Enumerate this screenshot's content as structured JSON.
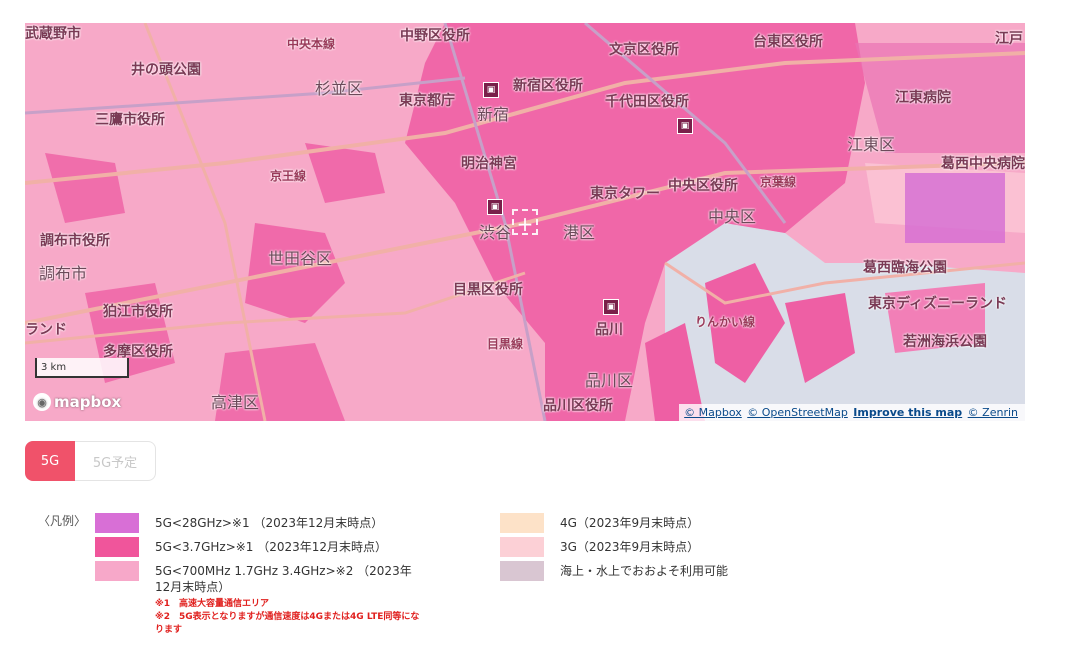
{
  "map": {
    "labels": {
      "nerima": "武蔵野市",
      "nakano_ku": "中野区役所",
      "chuo_line": "中央本線",
      "bunkyo": "文京区役所",
      "taito": "台東区役所",
      "edogawa": "江戸",
      "inokashira": "井の頭公園",
      "suginami": "杉並区",
      "tokyo_to": "東京都庁",
      "shinjuku_ku": "新宿区役所",
      "shinjuku": "新宿",
      "chiyoda": "千代田区役所",
      "koto_hosp": "江東病院",
      "mitaka": "三鷹市役所",
      "meiji": "明治神宮",
      "keio_line": "京王線",
      "koto": "江東区",
      "kasai": "葛西中央病院",
      "tokyo_tower": "東京タワー",
      "chuo_ku": "中央区役所",
      "chuo": "中央区",
      "keiyo": "京葉線",
      "chofu_yakusho": "調布市役所",
      "setagaya": "世田谷区",
      "shibuya": "渋谷",
      "minato": "港区",
      "chofu": "調布市",
      "higashi_kasai": "葛西臨海公園",
      "meguro": "目黒区役所",
      "komae": "狛江市役所",
      "disney": "東京ディズニーランド",
      "tama": "多摩区役所",
      "meguro_line": "目黒線",
      "shinagawa": "品川",
      "rinkai": "りんかい線",
      "wakasu": "若洲海浜公園",
      "lando": "ランド",
      "shinagawa_ku": "品川区",
      "takatsu": "高津区",
      "shinagawa_yakusho": "品川区役所",
      "nakano_road": "中野区役所"
    },
    "scale": "3 km",
    "logo": "mapbox",
    "attribution": {
      "mapbox": "© Mapbox",
      "osm": "© OpenStreetMap",
      "improve": "Improve this map",
      "zenrin": "© Zenrin"
    }
  },
  "tabs": {
    "active": "5G",
    "inactive": "5G予定"
  },
  "legend": {
    "title": "〈凡例〉",
    "items": [
      {
        "label": "5G<28GHz>※1 （2023年12月末時点）",
        "color": "#d86fd6"
      },
      {
        "label": "5G<3.7GHz>※1 （2023年12月末時点）",
        "color": "#f0559b"
      },
      {
        "label": "5G<700MHz 1.7GHz 3.4GHz>※2 （2023年12月末時点）",
        "color": "#f7a8c9"
      },
      {
        "label": "4G（2023年9月末時点）",
        "color": "#fde2c8"
      },
      {
        "label": "3G（2023年9月末時点）",
        "color": "#fcd0d6"
      },
      {
        "label": "海上・水上でおおよそ利用可能",
        "color": "#d9c6d2"
      }
    ],
    "notes": {
      "note1": "※1　高速大容量通信エリア",
      "note2": "※2　5G表示となりますが通信速度は4Gまたは4G LTE同等になります"
    }
  }
}
